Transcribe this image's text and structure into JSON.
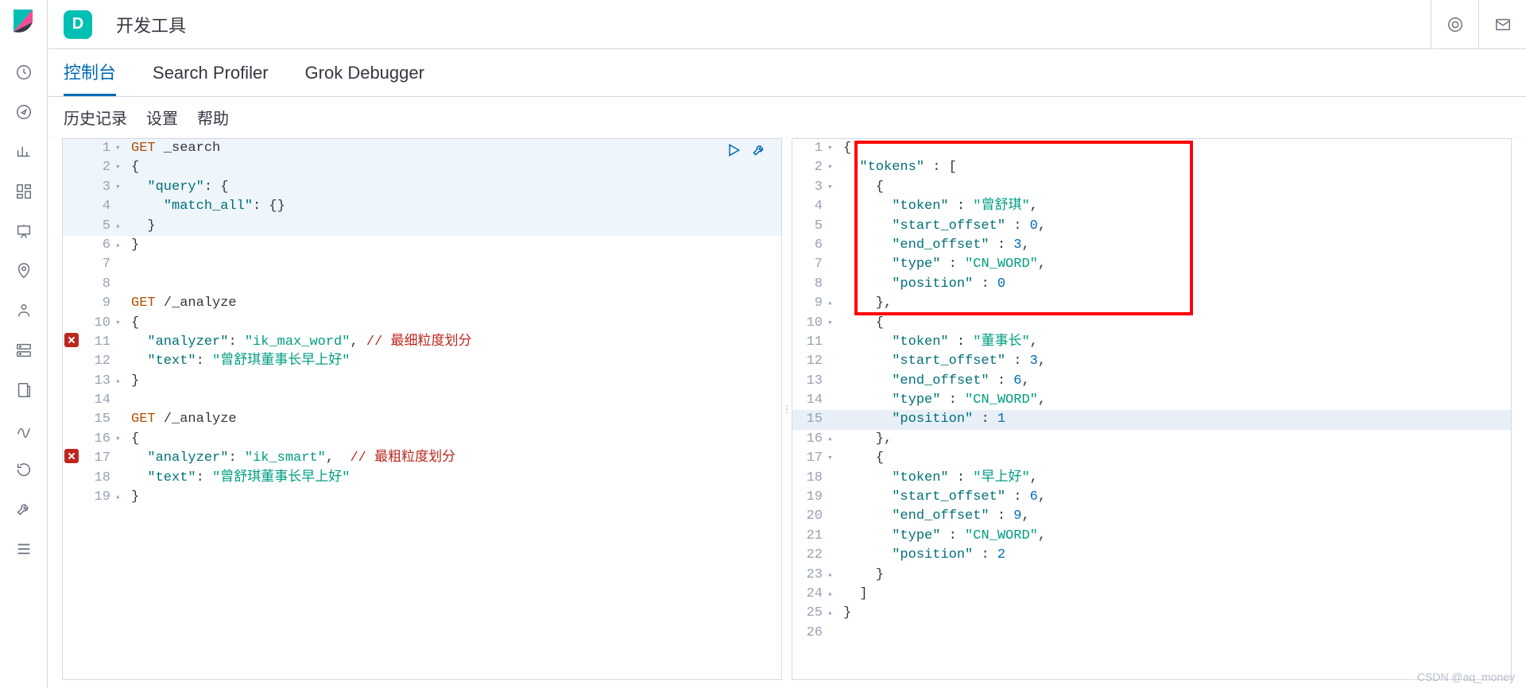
{
  "header": {
    "badge_letter": "D",
    "title": "开发工具"
  },
  "tabs": [
    {
      "label": "控制台",
      "active": true
    },
    {
      "label": "Search Profiler",
      "active": false
    },
    {
      "label": "Grok Debugger",
      "active": false
    }
  ],
  "menubar": [
    "历史记录",
    "设置",
    "帮助"
  ],
  "left_editor": {
    "lines": [
      {
        "n": 1,
        "fold": "down",
        "hl": true,
        "err": false,
        "tokens": [
          {
            "t": "GET",
            "c": "kw"
          },
          {
            "t": " ",
            "c": "id"
          },
          {
            "t": "_search",
            "c": "id"
          }
        ]
      },
      {
        "n": 2,
        "fold": "down",
        "hl": true,
        "err": false,
        "tokens": [
          {
            "t": "{",
            "c": "punc"
          }
        ]
      },
      {
        "n": 3,
        "fold": "down",
        "hl": true,
        "err": false,
        "tokens": [
          {
            "t": "  ",
            "c": "id"
          },
          {
            "t": "\"query\"",
            "c": "key"
          },
          {
            "t": ": {",
            "c": "punc"
          }
        ]
      },
      {
        "n": 4,
        "fold": "",
        "hl": true,
        "err": false,
        "tokens": [
          {
            "t": "    ",
            "c": "id"
          },
          {
            "t": "\"match_all\"",
            "c": "key"
          },
          {
            "t": ": {}",
            "c": "punc"
          }
        ]
      },
      {
        "n": 5,
        "fold": "up",
        "hl": true,
        "err": false,
        "tokens": [
          {
            "t": "  }",
            "c": "punc"
          }
        ]
      },
      {
        "n": 6,
        "fold": "up",
        "hl": false,
        "err": false,
        "tokens": [
          {
            "t": "}",
            "c": "punc"
          }
        ]
      },
      {
        "n": 7,
        "fold": "",
        "hl": false,
        "err": false,
        "tokens": []
      },
      {
        "n": 8,
        "fold": "",
        "hl": false,
        "err": false,
        "tokens": []
      },
      {
        "n": 9,
        "fold": "",
        "hl": false,
        "err": false,
        "tokens": [
          {
            "t": "GET",
            "c": "kw"
          },
          {
            "t": " /_analyze",
            "c": "id"
          }
        ]
      },
      {
        "n": 10,
        "fold": "down",
        "hl": false,
        "err": false,
        "tokens": [
          {
            "t": "{",
            "c": "punc"
          }
        ]
      },
      {
        "n": 11,
        "fold": "",
        "hl": false,
        "err": true,
        "tokens": [
          {
            "t": "  ",
            "c": "id"
          },
          {
            "t": "\"analyzer\"",
            "c": "key"
          },
          {
            "t": ": ",
            "c": "punc"
          },
          {
            "t": "\"ik_max_word\"",
            "c": "str"
          },
          {
            "t": ", ",
            "c": "punc"
          },
          {
            "t": "// 最细粒度划分",
            "c": "com"
          }
        ]
      },
      {
        "n": 12,
        "fold": "",
        "hl": false,
        "err": false,
        "tokens": [
          {
            "t": "  ",
            "c": "id"
          },
          {
            "t": "\"text\"",
            "c": "key"
          },
          {
            "t": ": ",
            "c": "punc"
          },
          {
            "t": "\"曾舒琪董事长早上好\"",
            "c": "str"
          }
        ]
      },
      {
        "n": 13,
        "fold": "up",
        "hl": false,
        "err": false,
        "tokens": [
          {
            "t": "}",
            "c": "punc"
          }
        ]
      },
      {
        "n": 14,
        "fold": "",
        "hl": false,
        "err": false,
        "tokens": []
      },
      {
        "n": 15,
        "fold": "",
        "hl": false,
        "err": false,
        "tokens": [
          {
            "t": "GET",
            "c": "kw"
          },
          {
            "t": " /_analyze",
            "c": "id"
          }
        ]
      },
      {
        "n": 16,
        "fold": "down",
        "hl": false,
        "err": false,
        "tokens": [
          {
            "t": "{",
            "c": "punc"
          }
        ]
      },
      {
        "n": 17,
        "fold": "",
        "hl": false,
        "err": true,
        "tokens": [
          {
            "t": "  ",
            "c": "id"
          },
          {
            "t": "\"analyzer\"",
            "c": "key"
          },
          {
            "t": ": ",
            "c": "punc"
          },
          {
            "t": "\"ik_smart\"",
            "c": "str"
          },
          {
            "t": ",  ",
            "c": "punc"
          },
          {
            "t": "// 最粗粒度划分",
            "c": "com"
          }
        ]
      },
      {
        "n": 18,
        "fold": "",
        "hl": false,
        "err": false,
        "tokens": [
          {
            "t": "  ",
            "c": "id"
          },
          {
            "t": "\"text\"",
            "c": "key"
          },
          {
            "t": ": ",
            "c": "punc"
          },
          {
            "t": "\"曾舒琪董事长早上好\"",
            "c": "str"
          }
        ]
      },
      {
        "n": 19,
        "fold": "up",
        "hl": false,
        "err": false,
        "tokens": [
          {
            "t": "}",
            "c": "punc"
          }
        ]
      }
    ]
  },
  "right_editor": {
    "lines": [
      {
        "n": 1,
        "fold": "down",
        "hl": false,
        "tokens": [
          {
            "t": "{",
            "c": "punc"
          }
        ]
      },
      {
        "n": 2,
        "fold": "down",
        "hl": false,
        "tokens": [
          {
            "t": "  ",
            "c": "id"
          },
          {
            "t": "\"tokens\"",
            "c": "key"
          },
          {
            "t": " : [",
            "c": "punc"
          }
        ]
      },
      {
        "n": 3,
        "fold": "down",
        "hl": false,
        "tokens": [
          {
            "t": "    {",
            "c": "punc"
          }
        ]
      },
      {
        "n": 4,
        "fold": "",
        "hl": false,
        "tokens": [
          {
            "t": "      ",
            "c": "id"
          },
          {
            "t": "\"token\"",
            "c": "key"
          },
          {
            "t": " : ",
            "c": "punc"
          },
          {
            "t": "\"曾舒琪\"",
            "c": "str"
          },
          {
            "t": ",",
            "c": "punc"
          }
        ]
      },
      {
        "n": 5,
        "fold": "",
        "hl": false,
        "tokens": [
          {
            "t": "      ",
            "c": "id"
          },
          {
            "t": "\"start_offset\"",
            "c": "key"
          },
          {
            "t": " : ",
            "c": "punc"
          },
          {
            "t": "0",
            "c": "num"
          },
          {
            "t": ",",
            "c": "punc"
          }
        ]
      },
      {
        "n": 6,
        "fold": "",
        "hl": false,
        "tokens": [
          {
            "t": "      ",
            "c": "id"
          },
          {
            "t": "\"end_offset\"",
            "c": "key"
          },
          {
            "t": " : ",
            "c": "punc"
          },
          {
            "t": "3",
            "c": "num"
          },
          {
            "t": ",",
            "c": "punc"
          }
        ]
      },
      {
        "n": 7,
        "fold": "",
        "hl": false,
        "tokens": [
          {
            "t": "      ",
            "c": "id"
          },
          {
            "t": "\"type\"",
            "c": "key"
          },
          {
            "t": " : ",
            "c": "punc"
          },
          {
            "t": "\"CN_WORD\"",
            "c": "str"
          },
          {
            "t": ",",
            "c": "punc"
          }
        ]
      },
      {
        "n": 8,
        "fold": "",
        "hl": false,
        "tokens": [
          {
            "t": "      ",
            "c": "id"
          },
          {
            "t": "\"position\"",
            "c": "key"
          },
          {
            "t": " : ",
            "c": "punc"
          },
          {
            "t": "0",
            "c": "num"
          }
        ]
      },
      {
        "n": 9,
        "fold": "up",
        "hl": false,
        "tokens": [
          {
            "t": "    },",
            "c": "punc"
          }
        ]
      },
      {
        "n": 10,
        "fold": "down",
        "hl": false,
        "tokens": [
          {
            "t": "    {",
            "c": "punc"
          }
        ]
      },
      {
        "n": 11,
        "fold": "",
        "hl": false,
        "tokens": [
          {
            "t": "      ",
            "c": "id"
          },
          {
            "t": "\"token\"",
            "c": "key"
          },
          {
            "t": " : ",
            "c": "punc"
          },
          {
            "t": "\"董事长\"",
            "c": "str"
          },
          {
            "t": ",",
            "c": "punc"
          }
        ]
      },
      {
        "n": 12,
        "fold": "",
        "hl": false,
        "tokens": [
          {
            "t": "      ",
            "c": "id"
          },
          {
            "t": "\"start_offset\"",
            "c": "key"
          },
          {
            "t": " : ",
            "c": "punc"
          },
          {
            "t": "3",
            "c": "num"
          },
          {
            "t": ",",
            "c": "punc"
          }
        ]
      },
      {
        "n": 13,
        "fold": "",
        "hl": false,
        "tokens": [
          {
            "t": "      ",
            "c": "id"
          },
          {
            "t": "\"end_offset\"",
            "c": "key"
          },
          {
            "t": " : ",
            "c": "punc"
          },
          {
            "t": "6",
            "c": "num"
          },
          {
            "t": ",",
            "c": "punc"
          }
        ]
      },
      {
        "n": 14,
        "fold": "",
        "hl": false,
        "tokens": [
          {
            "t": "      ",
            "c": "id"
          },
          {
            "t": "\"type\"",
            "c": "key"
          },
          {
            "t": " : ",
            "c": "punc"
          },
          {
            "t": "\"CN_WORD\"",
            "c": "str"
          },
          {
            "t": ",",
            "c": "punc"
          }
        ]
      },
      {
        "n": 15,
        "fold": "",
        "hl": true,
        "tokens": [
          {
            "t": "      ",
            "c": "id"
          },
          {
            "t": "\"position\"",
            "c": "key"
          },
          {
            "t": " : ",
            "c": "punc"
          },
          {
            "t": "1",
            "c": "num"
          }
        ]
      },
      {
        "n": 16,
        "fold": "up",
        "hl": false,
        "tokens": [
          {
            "t": "    },",
            "c": "punc"
          }
        ]
      },
      {
        "n": 17,
        "fold": "down",
        "hl": false,
        "tokens": [
          {
            "t": "    {",
            "c": "punc"
          }
        ]
      },
      {
        "n": 18,
        "fold": "",
        "hl": false,
        "tokens": [
          {
            "t": "      ",
            "c": "id"
          },
          {
            "t": "\"token\"",
            "c": "key"
          },
          {
            "t": " : ",
            "c": "punc"
          },
          {
            "t": "\"早上好\"",
            "c": "str"
          },
          {
            "t": ",",
            "c": "punc"
          }
        ]
      },
      {
        "n": 19,
        "fold": "",
        "hl": false,
        "tokens": [
          {
            "t": "      ",
            "c": "id"
          },
          {
            "t": "\"start_offset\"",
            "c": "key"
          },
          {
            "t": " : ",
            "c": "punc"
          },
          {
            "t": "6",
            "c": "num"
          },
          {
            "t": ",",
            "c": "punc"
          }
        ]
      },
      {
        "n": 20,
        "fold": "",
        "hl": false,
        "tokens": [
          {
            "t": "      ",
            "c": "id"
          },
          {
            "t": "\"end_offset\"",
            "c": "key"
          },
          {
            "t": " : ",
            "c": "punc"
          },
          {
            "t": "9",
            "c": "num"
          },
          {
            "t": ",",
            "c": "punc"
          }
        ]
      },
      {
        "n": 21,
        "fold": "",
        "hl": false,
        "tokens": [
          {
            "t": "      ",
            "c": "id"
          },
          {
            "t": "\"type\"",
            "c": "key"
          },
          {
            "t": " : ",
            "c": "punc"
          },
          {
            "t": "\"CN_WORD\"",
            "c": "str"
          },
          {
            "t": ",",
            "c": "punc"
          }
        ]
      },
      {
        "n": 22,
        "fold": "",
        "hl": false,
        "tokens": [
          {
            "t": "      ",
            "c": "id"
          },
          {
            "t": "\"position\"",
            "c": "key"
          },
          {
            "t": " : ",
            "c": "punc"
          },
          {
            "t": "2",
            "c": "num"
          }
        ]
      },
      {
        "n": 23,
        "fold": "up",
        "hl": false,
        "tokens": [
          {
            "t": "    }",
            "c": "punc"
          }
        ]
      },
      {
        "n": 24,
        "fold": "up",
        "hl": false,
        "tokens": [
          {
            "t": "  ]",
            "c": "punc"
          }
        ]
      },
      {
        "n": 25,
        "fold": "up",
        "hl": false,
        "tokens": [
          {
            "t": "}",
            "c": "punc"
          }
        ]
      },
      {
        "n": 26,
        "fold": "",
        "hl": false,
        "tokens": []
      }
    ]
  },
  "fold_glyphs": {
    "down": "▾",
    "up": "▴"
  },
  "watermark": "CSDN @aq_money"
}
